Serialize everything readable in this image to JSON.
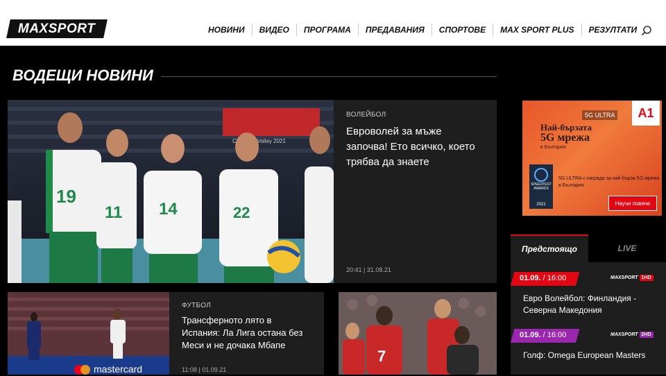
{
  "brand": {
    "logo_text": "MAXSPORT"
  },
  "nav": [
    {
      "label": "НОВИНИ"
    },
    {
      "label": "ВИДЕО"
    },
    {
      "label": "ПРОГРАМА"
    },
    {
      "label": "ПРЕДАВАНИЯ"
    },
    {
      "label": "СПОРТОВЕ"
    },
    {
      "label": "MAX SPORT PLUS"
    },
    {
      "label": "РЕЗУЛТАТИ"
    }
  ],
  "section": {
    "title": "ВОДЕЩИ НОВИНИ"
  },
  "hero": {
    "category": "ВОЛЕЙБОЛ",
    "title": "Евроволей за мъже започва! Ето всичко, което трябва да знаете",
    "date": "20:41 | 31.08.21",
    "image_caption": "CEV EuroVolley 2021"
  },
  "article2": {
    "category": "ФУТБОЛ",
    "title": "Трансферното лято в Испания: Ла Лига остана без Меси и не дочака Мбапе",
    "date": "11:08 | 01.09.21",
    "image_caption": "mastercard"
  },
  "ad": {
    "badge": "5G ULTRA",
    "brand": "A1",
    "headline_1": "Най-бързата",
    "headline_2": "5G мрежа",
    "headline_3": "в България",
    "award": "SPEEDTEST AWARDS",
    "award_year": "2021",
    "body": "5G ULTRA с награда за най-бърза 5G мрежа в България",
    "cta": "Научи повече"
  },
  "schedule": {
    "tabs": [
      {
        "label": "Предстоящо"
      },
      {
        "label": "LIVE"
      }
    ],
    "items": [
      {
        "date": "01.09.",
        "time": "16:00",
        "channel": "MAXSPORT",
        "hd": "1HD",
        "color": "#e30613",
        "hd_color": "#e30613",
        "title": "Евро Волейбол: Финландия - Северна Македония"
      },
      {
        "date": "01.09.",
        "time": "16:00",
        "channel": "MAXSPORT",
        "hd": "2HD",
        "color": "#9b27af",
        "hd_color": "#9b27af",
        "title": "Голф: Omega European Masters"
      }
    ]
  }
}
